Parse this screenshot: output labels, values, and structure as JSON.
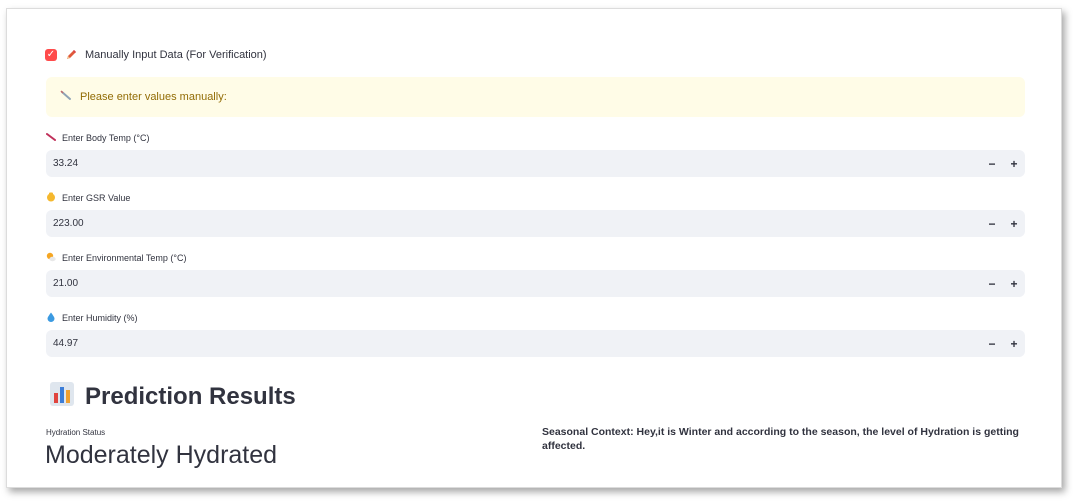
{
  "manual_input": {
    "checkbox_checked": true,
    "checkbox_label": "Manually Input Data (For Verification)",
    "icon": "pencil-icon"
  },
  "alert": {
    "text": "Please enter values manually:",
    "icon": "syringe-icon",
    "color": "#926c05",
    "background": "#fffce7"
  },
  "fields": {
    "body_temp": {
      "label": "Enter Body Temp (°C)",
      "value": "33.24",
      "icon": "thermometer-icon"
    },
    "gsr": {
      "label": "Enter GSR Value",
      "value": "223.00",
      "icon": "hand-icon"
    },
    "env_temp": {
      "label": "Enter Environmental Temp (°C)",
      "value": "21.00",
      "icon": "sun-cloud-icon"
    },
    "humidity": {
      "label": "Enter Humidity (%)",
      "value": "44.97",
      "icon": "droplet-icon"
    }
  },
  "stepper": {
    "minus": "−",
    "plus": "+"
  },
  "results": {
    "title": "Prediction Results",
    "icon": "bar-chart-icon",
    "metric_label": "Hydration Status",
    "metric_value": "Moderately Hydrated",
    "seasonal_context": "Seasonal Context: Hey,it is Winter and according to the season, the level of Hydration is getting affected."
  },
  "colors": {
    "accent": "#ff4b4b",
    "input_bg": "#f0f2f6",
    "text": "#31333f"
  }
}
